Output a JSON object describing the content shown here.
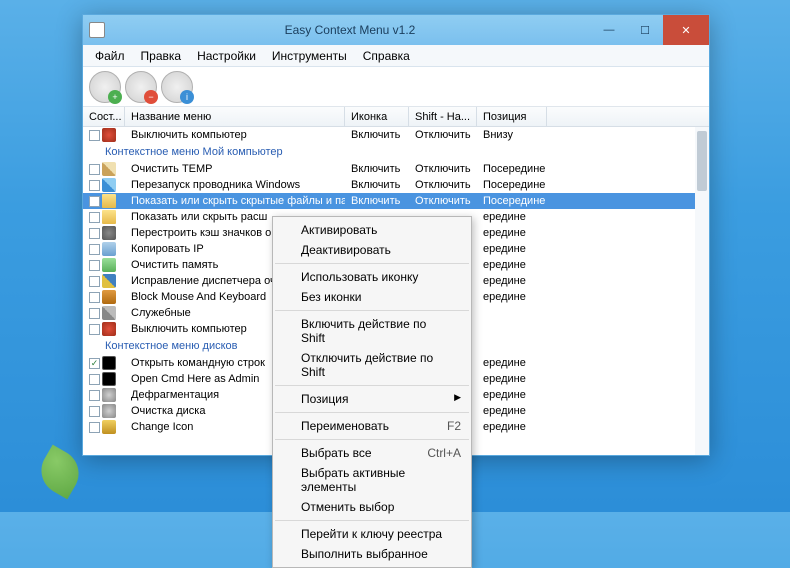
{
  "window": {
    "title": "Easy Context Menu v1.2"
  },
  "menubar": [
    "Файл",
    "Правка",
    "Настройки",
    "Инструменты",
    "Справка"
  ],
  "toolbar": [
    {
      "name": "apply-button",
      "badge": "add"
    },
    {
      "name": "remove-button",
      "badge": "rem"
    },
    {
      "name": "info-button",
      "badge": "inf"
    }
  ],
  "columns": {
    "state": "Сост...",
    "name": "Название меню",
    "icon": "Иконка",
    "shift": "Shift - На...",
    "position": "Позиция"
  },
  "groups": [
    {
      "title": "",
      "items": [
        {
          "name": "Выключить компьютер",
          "icon": "power",
          "col_icon": "Включить",
          "col_shift": "Отключить",
          "col_pos": "Внизу"
        }
      ]
    },
    {
      "title": "Контекстное меню Мой компьютер",
      "items": [
        {
          "name": "Очистить TEMP",
          "icon": "broom",
          "col_icon": "Включить",
          "col_shift": "Отключить",
          "col_pos": "Посередине"
        },
        {
          "name": "Перезапуск проводника Windows",
          "icon": "win",
          "col_icon": "Включить",
          "col_shift": "Отключить",
          "col_pos": "Посередине"
        },
        {
          "name": "Показать или скрыть скрытые файлы и папки",
          "icon": "folder",
          "col_icon": "Включить",
          "col_shift": "Отключить",
          "col_pos": "Посередине",
          "selected": true
        },
        {
          "name": "Показать или скрыть расш",
          "icon": "folder",
          "col_icon": "",
          "col_shift": "",
          "col_pos": "ередине"
        },
        {
          "name": "Перестроить кэш значков о",
          "icon": "gear",
          "col_icon": "",
          "col_shift": "",
          "col_pos": "ередине"
        },
        {
          "name": "Копировать IP",
          "icon": "copy",
          "col_icon": "",
          "col_shift": "",
          "col_pos": "ередине"
        },
        {
          "name": "Очистить память",
          "icon": "ram",
          "col_icon": "",
          "col_shift": "",
          "col_pos": "ередине"
        },
        {
          "name": "Исправление диспетчера оч",
          "icon": "shield",
          "col_icon": "",
          "col_shift": "",
          "col_pos": "ередине"
        },
        {
          "name": "Block Mouse And Keyboard",
          "icon": "lock",
          "col_icon": "",
          "col_shift": "",
          "col_pos": "ередине"
        },
        {
          "name": "Служебные",
          "icon": "tools",
          "col_icon": "",
          "col_shift": "",
          "col_pos": ""
        },
        {
          "name": "Выключить компьютер",
          "icon": "power",
          "col_icon": "",
          "col_shift": "",
          "col_pos": ""
        }
      ]
    },
    {
      "title": "Контекстное меню дисков",
      "items": [
        {
          "name": "Открыть командную строк",
          "icon": "cmd",
          "checked": true,
          "col_icon": "",
          "col_shift": "",
          "col_pos": "ередине"
        },
        {
          "name": "Open Cmd Here as Admin",
          "icon": "cmd",
          "col_icon": "",
          "col_shift": "",
          "col_pos": "ередине"
        },
        {
          "name": "Дефрагментация",
          "icon": "disk",
          "col_icon": "",
          "col_shift": "",
          "col_pos": "ередине"
        },
        {
          "name": "Очистка диска",
          "icon": "disk",
          "col_icon": "",
          "col_shift": "",
          "col_pos": "ередине"
        },
        {
          "name": "Change Icon",
          "icon": "key",
          "col_icon": "",
          "col_shift": "",
          "col_pos": "ередине"
        }
      ]
    }
  ],
  "context_menu": [
    {
      "type": "item",
      "label": "Активировать"
    },
    {
      "type": "item",
      "label": "Деактивировать"
    },
    {
      "type": "sep"
    },
    {
      "type": "item",
      "label": "Использовать иконку"
    },
    {
      "type": "item",
      "label": "Без иконки"
    },
    {
      "type": "sep"
    },
    {
      "type": "item",
      "label": "Включить действие по Shift"
    },
    {
      "type": "item",
      "label": "Отключить действие по Shift"
    },
    {
      "type": "sep"
    },
    {
      "type": "item",
      "label": "Позиция",
      "submenu": true
    },
    {
      "type": "sep"
    },
    {
      "type": "item",
      "label": "Переименовать",
      "hotkey": "F2"
    },
    {
      "type": "sep"
    },
    {
      "type": "item",
      "label": "Выбрать все",
      "hotkey": "Ctrl+A"
    },
    {
      "type": "item",
      "label": "Выбрать активные элементы"
    },
    {
      "type": "item",
      "label": "Отменить выбор"
    },
    {
      "type": "sep"
    },
    {
      "type": "item",
      "label": "Перейти к ключу реестра"
    },
    {
      "type": "item",
      "label": "Выполнить выбранное"
    }
  ]
}
